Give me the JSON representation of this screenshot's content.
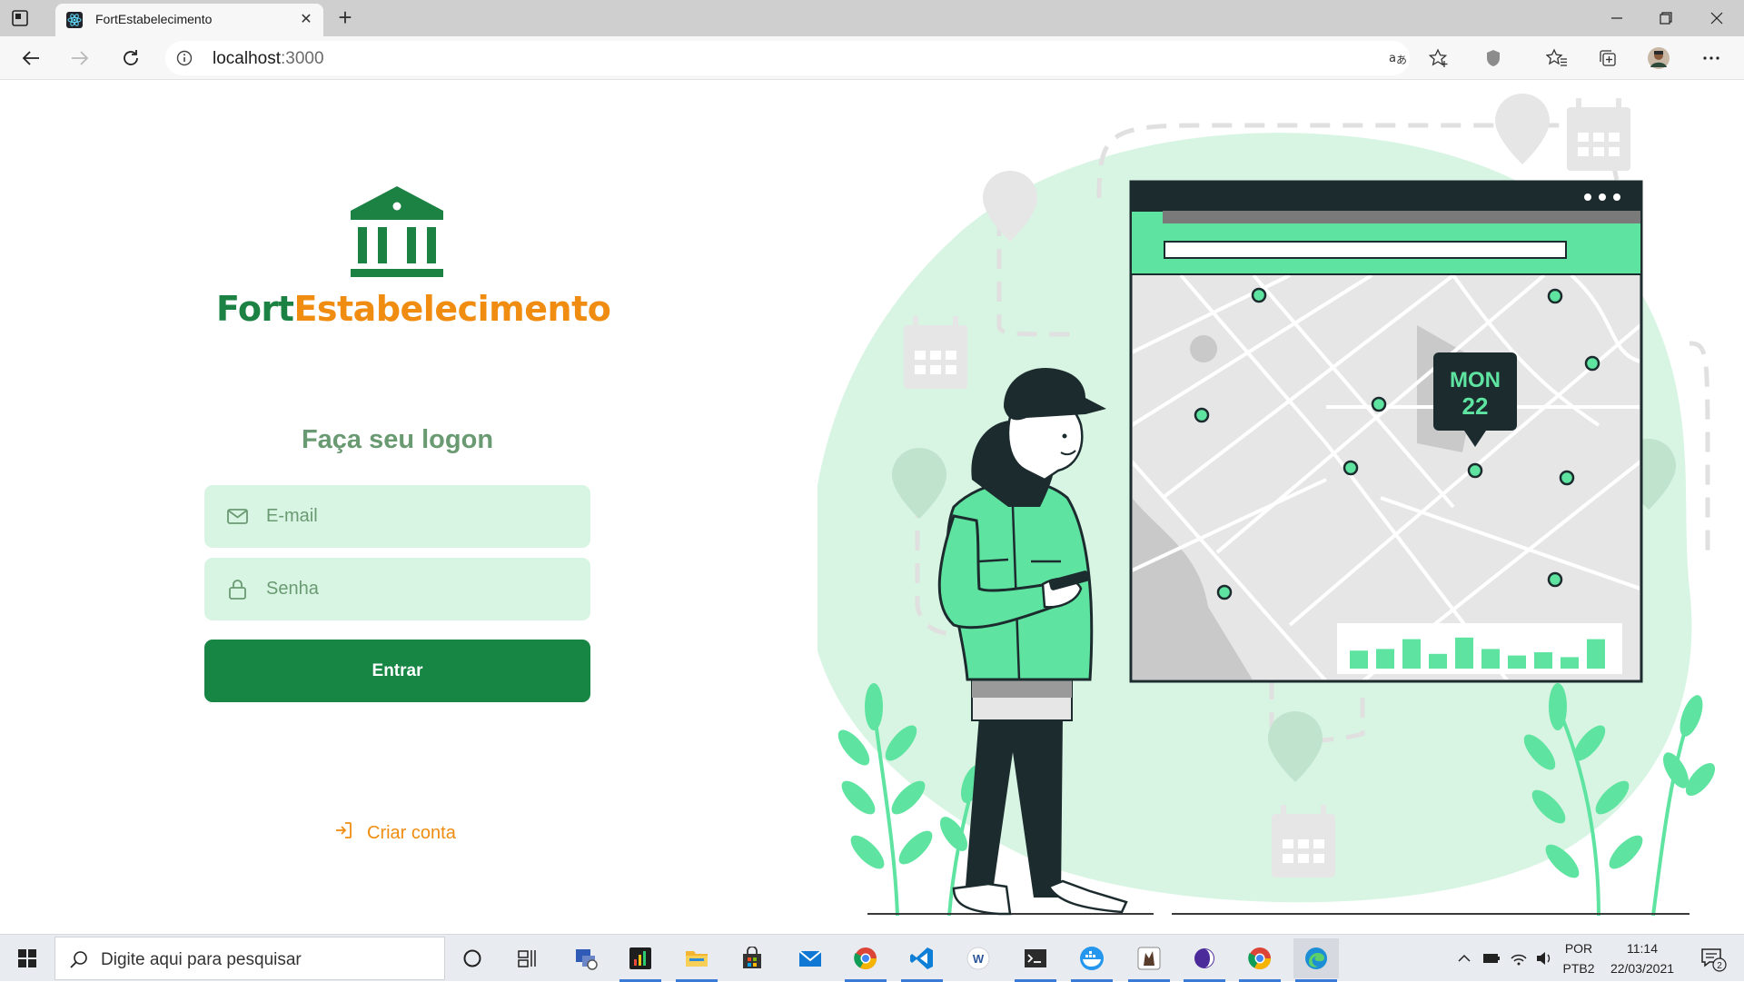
{
  "browser": {
    "tab_title": "FortEstabelecimento",
    "url_host": "localhost",
    "url_port": ":3000"
  },
  "brand": {
    "name_part1": "Fort",
    "name_part2": "Estabelecimento",
    "color_primary": "#1c8243",
    "color_accent": "#f08c10"
  },
  "login": {
    "title": "Faça seu logon",
    "email_placeholder": "E-mail",
    "password_placeholder": "Senha",
    "submit_label": "Entrar",
    "create_account_label": "Criar conta"
  },
  "illustration": {
    "calendar_badge_day": "MON",
    "calendar_badge_date": "22",
    "bar_heights": [
      0.55,
      0.6,
      0.9,
      0.45,
      0.95,
      0.6,
      0.4,
      0.5,
      0.35,
      0.9
    ]
  },
  "taskbar": {
    "search_placeholder": "Digite aqui para pesquisar",
    "language_top": "POR",
    "language_bottom": "PTB2",
    "time": "11:14",
    "date": "22/03/2021",
    "notification_count": "2",
    "icons": [
      "cortana-icon",
      "task-view-icon",
      "network-tool-icon",
      "media-app-icon",
      "file-explorer-icon",
      "store-icon",
      "mail-icon",
      "chrome-icon",
      "vscode-icon",
      "word-icon",
      "terminal-icon",
      "docker-icon",
      "insomnia-icon",
      "beekeeper-icon",
      "chrome-icon",
      "edge-icon"
    ]
  }
}
